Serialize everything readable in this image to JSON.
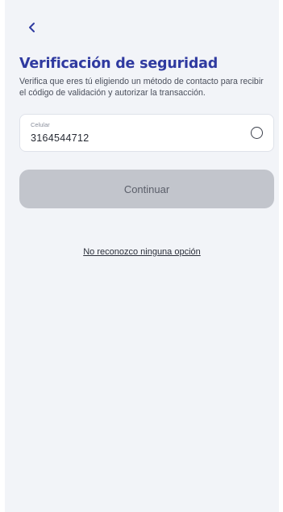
{
  "header": {
    "back_icon": "chevron-left-icon"
  },
  "title": "Verificación de seguridad",
  "subtitle": "Verifica que eres tú eligiendo un método de contacto para recibir el código de validación y autorizar la transacción.",
  "option": {
    "label": "Celular",
    "value": "3164544712",
    "selected": false
  },
  "continue_label": "Continuar",
  "unknown_option_link": "No reconozco ninguna opción",
  "colors": {
    "title": "#2f3aa0",
    "background": "#f2f4f8",
    "button_disabled": "#c2c5cc"
  }
}
